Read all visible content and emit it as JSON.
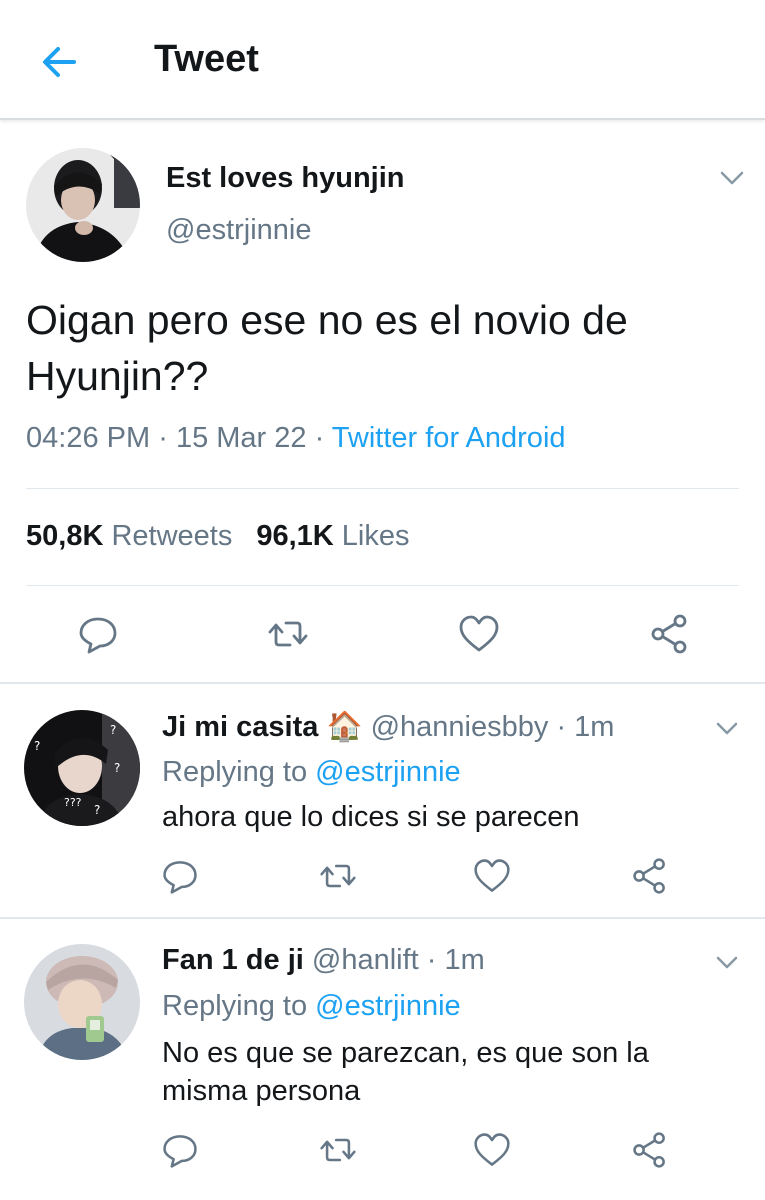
{
  "header": {
    "title": "Tweet",
    "back_icon": "arrow-left-icon",
    "accent": "#1da1f2"
  },
  "tweet": {
    "display_name": "Est loves hyunjin",
    "handle": "@estrjinnie",
    "text": "Oigan pero ese no es el novio de Hyunjin??",
    "time": "04:26 PM",
    "date": "15 Mar 22",
    "separator": "·",
    "source": "Twitter for Android",
    "retweets_count": "50,8K",
    "retweets_label": "Retweets",
    "likes_count": "96,1K",
    "likes_label": "Likes"
  },
  "replies": [
    {
      "display_name": "Ji mi casita",
      "emoji": "🏠",
      "handle": "@hanniesbby",
      "time": "· 1m",
      "replying_label": "Replying to",
      "replying_to": "@estrjinnie",
      "text": "ahora que lo dices si se parecen"
    },
    {
      "display_name": "Fan 1 de ji",
      "handle": "@hanlift",
      "time": "· 1m",
      "replying_label": "Replying to",
      "replying_to": "@estrjinnie",
      "text": "No es que se parezcan, es que son la misma persona"
    }
  ],
  "colors": {
    "text": "#14171a",
    "muted": "#657786",
    "link": "#1da1f2",
    "divider": "#e1e8ed"
  }
}
